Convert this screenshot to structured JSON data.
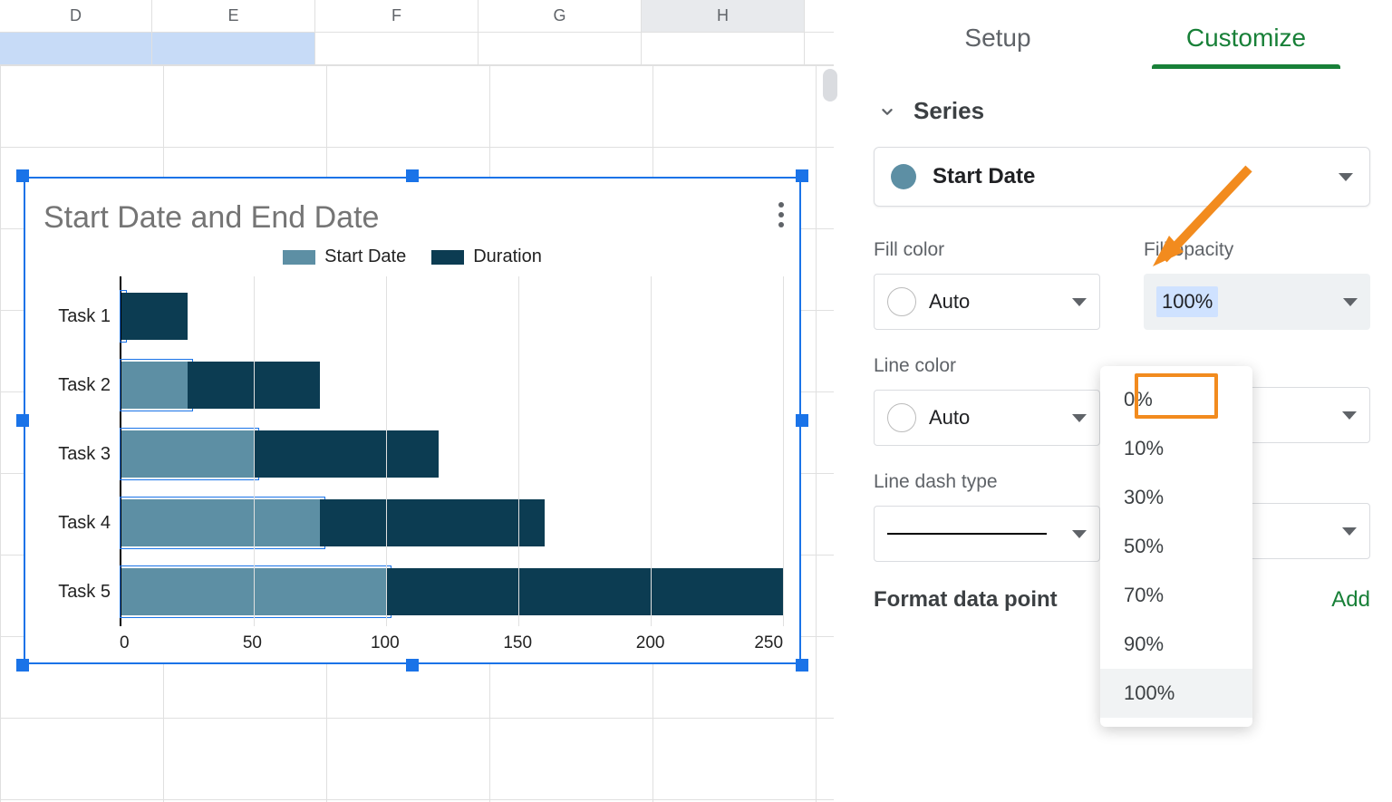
{
  "columns": [
    "D",
    "E",
    "F",
    "G",
    "H"
  ],
  "chart": {
    "title": "Start Date and End Date",
    "legend": [
      "Start Date",
      "Duration"
    ]
  },
  "chart_data": {
    "type": "bar",
    "orientation": "horizontal",
    "stacked": true,
    "title": "Start Date and End Date",
    "categories": [
      "Task 1",
      "Task 2",
      "Task 3",
      "Task 4",
      "Task 5"
    ],
    "series": [
      {
        "name": "Start Date",
        "color": "#5d8fa4",
        "values": [
          0,
          25,
          50,
          75,
          100
        ]
      },
      {
        "name": "Duration",
        "color": "#0c3c52",
        "values": [
          25,
          50,
          70,
          85,
          150
        ]
      }
    ],
    "xlabel": "",
    "ylabel": "",
    "xlim": [
      0,
      250
    ],
    "x_ticks": [
      0,
      50,
      100,
      150,
      200,
      250
    ],
    "selected_series": "Start Date"
  },
  "sidebar": {
    "tabs": {
      "setup": "Setup",
      "customize": "Customize"
    },
    "section": "Series",
    "series_selected": "Start Date",
    "fields": {
      "fill_color": {
        "label": "Fill color",
        "value": "Auto"
      },
      "fill_opacity": {
        "label": "Fill opacity",
        "value": "100%"
      },
      "line_color": {
        "label": "Line color",
        "value": "Auto"
      },
      "line_dash": {
        "label": "Line dash type"
      }
    },
    "opacity_options": [
      "0%",
      "10%",
      "30%",
      "50%",
      "70%",
      "90%",
      "100%"
    ],
    "format_label": "Format data point",
    "add_label": "Add"
  }
}
